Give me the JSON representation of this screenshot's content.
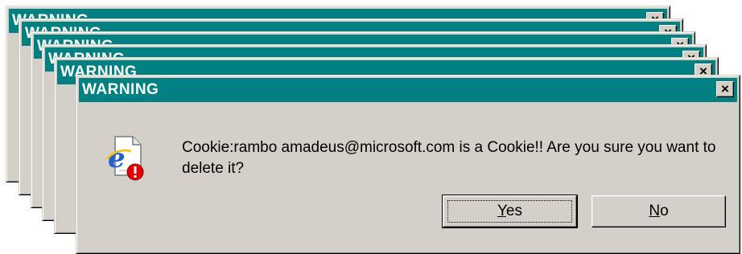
{
  "dialog": {
    "title": "WARNING",
    "close_glyph": "×",
    "message": "Cookie:rambo amadeus@microsoft.com is a Cookie!! Are you sure you want to delete it?",
    "icon": "ie-document-error-icon",
    "buttons": {
      "yes_mnemonic": "Y",
      "yes_rest": "es",
      "no_mnemonic": "N",
      "no_rest": "o"
    }
  },
  "colors": {
    "titlebar": "#008080",
    "face": "#d4d0c8",
    "title_text": "#ffffff",
    "error_badge": "#e00000",
    "ie_blue": "#1f5fd0"
  }
}
